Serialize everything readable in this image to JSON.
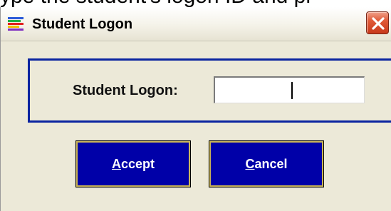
{
  "background": {
    "text": "ype the student's logon ID and pr"
  },
  "window": {
    "title": "Student Logon",
    "icon": "app-icon",
    "close_icon": "close-icon"
  },
  "logon": {
    "label": "Student Logon:",
    "value": ""
  },
  "buttons": {
    "accept": {
      "mnemonic": "A",
      "rest": "ccept"
    },
    "cancel": {
      "mnemonic": "C",
      "rest": "ancel"
    }
  },
  "colors": {
    "panel_border": "#0a24a0",
    "button_bg": "#0000a8",
    "button_border": "#c9b458",
    "close_button": "#e05a38"
  }
}
